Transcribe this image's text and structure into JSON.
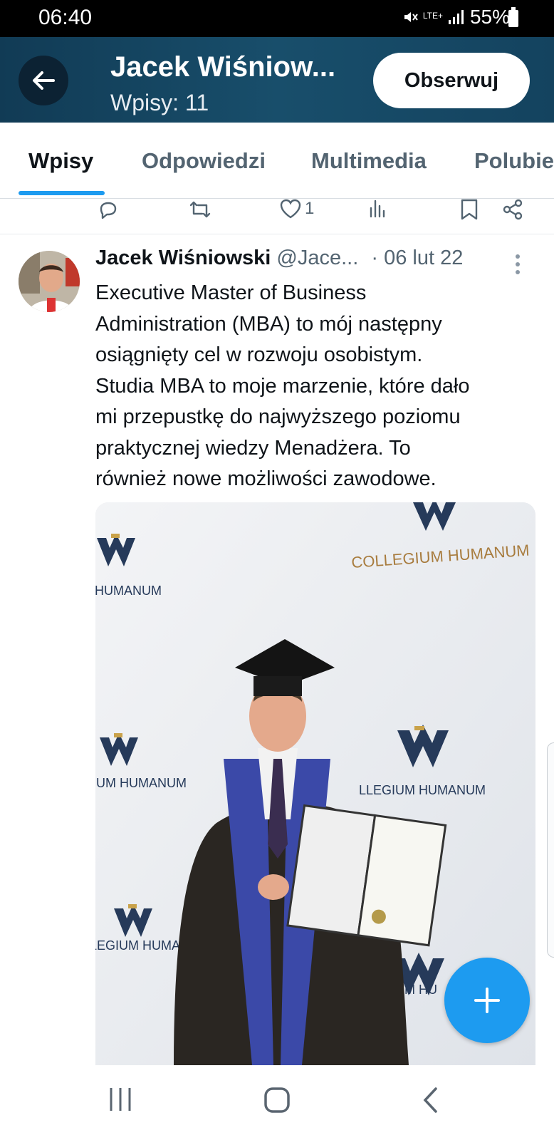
{
  "status_bar": {
    "time": "06:40",
    "network": "LTE+",
    "battery": "55%"
  },
  "header": {
    "name": "Jacek Wiśniow...",
    "posts_count": "Wpisy: 11",
    "follow_label": "Obserwuj"
  },
  "tabs": [
    {
      "label": "Wpisy",
      "active": true
    },
    {
      "label": "Odpowiedzi",
      "active": false
    },
    {
      "label": "Multimedia",
      "active": false
    },
    {
      "label": "Polubie",
      "active": false
    }
  ],
  "prev_actions": {
    "like_count": "1"
  },
  "tweet": {
    "author": "Jacek Wiśniowski",
    "handle": "@Jace...",
    "date": "· 06 lut 22",
    "text_lines": [
      "Executive Master of Business",
      "Administration (MBA) to mój następny",
      "osiągnięty cel w rozwoju osobistym.",
      "Studia MBA to moje marzenie, które dało",
      "mi przepustkę do najwyższego poziomu",
      "praktycznej wiedzy Menadżera. To",
      "również nowe możliwości zawodowe."
    ],
    "media": {
      "backdrop_label": "COLLEGIUM HUMANUM"
    }
  },
  "colors": {
    "accent": "#1d9bf0",
    "header_bg": "#184e6b",
    "muted": "#536471"
  },
  "icons": [
    "back-arrow-icon",
    "reply-icon",
    "retweet-icon",
    "like-icon",
    "views-icon",
    "bookmark-icon",
    "share-icon",
    "more-icon",
    "compose-plus-icon",
    "recents-icon",
    "home-icon",
    "back-nav-icon"
  ]
}
